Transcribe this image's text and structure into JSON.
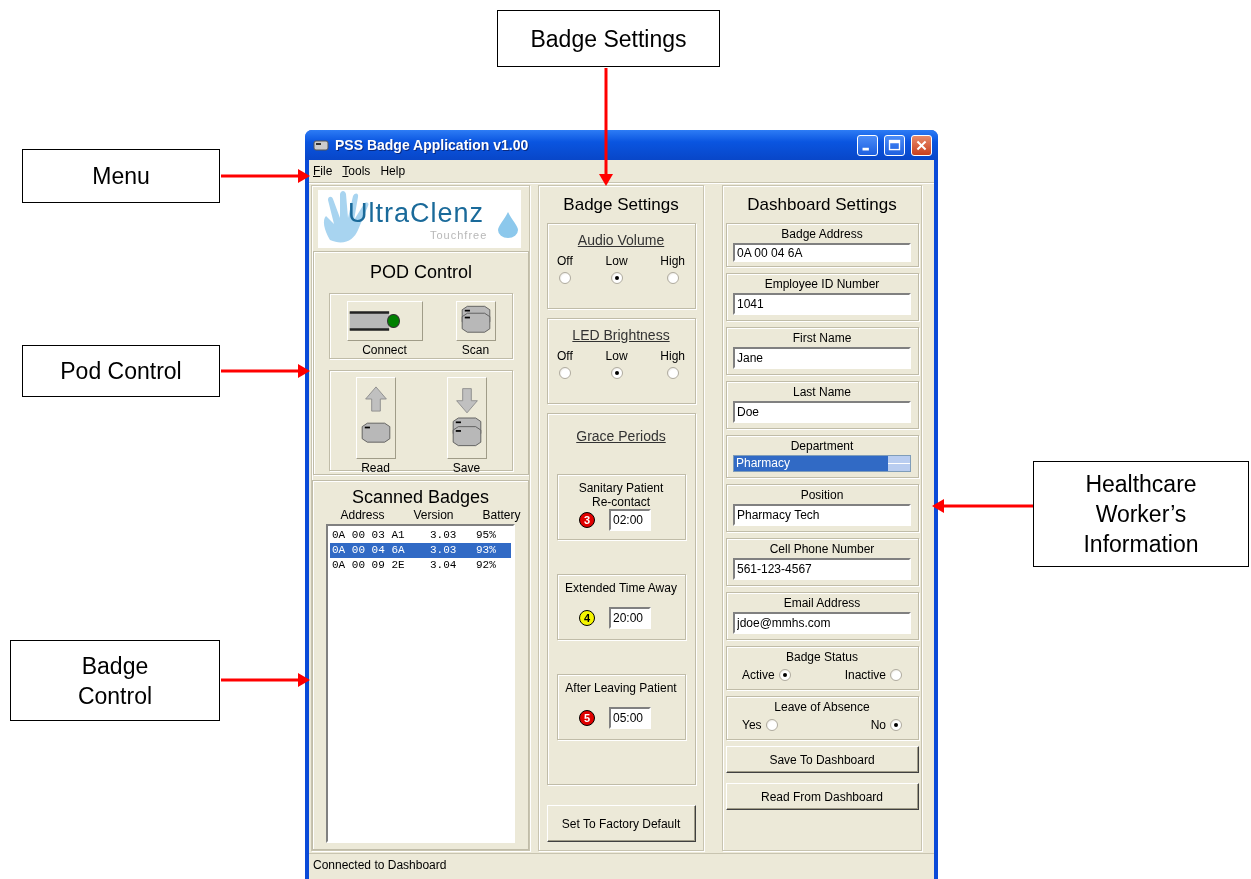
{
  "annotations": [
    {
      "label": "Badge Settings"
    },
    {
      "label": "Menu"
    },
    {
      "label": "Pod Control"
    },
    {
      "label": "Healthcare Worker’s Information"
    },
    {
      "label": "Badge Control"
    }
  ],
  "window": {
    "title": "PSS Badge Application v1.00"
  },
  "menu": [
    {
      "label": "File",
      "access_key_underlined": true
    },
    {
      "label": "Tools",
      "access_key_underlined": true
    },
    {
      "label": "Help",
      "access_key_underlined": false
    }
  ],
  "logo": {
    "name": "UltraClenz",
    "tagline": "Touchfree"
  },
  "pod_control": {
    "title": "POD Control",
    "buttons": [
      {
        "label": "Connect",
        "kind": "connect",
        "connected": true
      },
      {
        "label": "Scan",
        "kind": "scan"
      },
      {
        "label": "Read",
        "kind": "read"
      },
      {
        "label": "Save",
        "kind": "save"
      }
    ]
  },
  "scanned_badges": {
    "title": "Scanned Badges",
    "columns": [
      "Address",
      "Version",
      "Battery"
    ],
    "rows": [
      {
        "address": "0A 00 03 A1",
        "version": "3.03",
        "battery": "95%",
        "selected": false
      },
      {
        "address": "0A 00 04 6A",
        "version": "3.03",
        "battery": "93%",
        "selected": true
      },
      {
        "address": "0A 00 09 2E",
        "version": "3.04",
        "battery": "92%",
        "selected": false
      }
    ]
  },
  "badge_settings": {
    "title": "Badge Settings",
    "option_groups": [
      {
        "title": "Audio Volume",
        "options": [
          {
            "label": "Off",
            "selected": false
          },
          {
            "label": "Low",
            "selected": true
          },
          {
            "label": "High",
            "selected": false
          }
        ]
      },
      {
        "title": "LED Brightness",
        "options": [
          {
            "label": "Off",
            "selected": false
          },
          {
            "label": "Low",
            "selected": true
          },
          {
            "label": "High",
            "selected": false
          }
        ]
      }
    ],
    "grace_periods": {
      "title": "Grace Periods",
      "items": [
        {
          "label": "Sanitary Patient Re-contact",
          "number": "3",
          "color": "#e00000",
          "value": "02:00"
        },
        {
          "label": "Extended Time Away",
          "number": "4",
          "color": "#f5f500",
          "value": "20:00"
        },
        {
          "label": "After Leaving Patient",
          "number": "5",
          "color": "#e00000",
          "value": "05:00"
        }
      ]
    },
    "factory_default_button": "Set To Factory Default"
  },
  "dashboard_settings": {
    "title": "Dashboard Settings",
    "fields": [
      {
        "label": "Badge Address",
        "value": "0A 00 04 6A",
        "kind": "text"
      },
      {
        "label": "Employee ID Number",
        "value": "1041",
        "kind": "text"
      },
      {
        "label": "First Name",
        "value": "Jane",
        "kind": "text"
      },
      {
        "label": "Last Name",
        "value": "Doe",
        "kind": "text"
      },
      {
        "label": "Department",
        "value": "Pharmacy",
        "kind": "dropdown"
      },
      {
        "label": "Position",
        "value": "Pharmacy Tech",
        "kind": "text"
      },
      {
        "label": "Cell Phone Number",
        "value": "561-123-4567",
        "kind": "text"
      },
      {
        "label": "Email Address",
        "value": "jdoe@mmhs.com",
        "kind": "text"
      }
    ],
    "radio_groups": [
      {
        "title": "Badge Status",
        "options": [
          {
            "label": "Active",
            "selected": true
          },
          {
            "label": "Inactive",
            "selected": false
          }
        ]
      },
      {
        "title": "Leave of Absence",
        "options": [
          {
            "label": "Yes",
            "selected": false
          },
          {
            "label": "No",
            "selected": true
          }
        ]
      }
    ],
    "buttons": [
      "Save To Dashboard",
      "Read From Dashboard"
    ]
  },
  "status_bar": "Connected to Dashboard"
}
